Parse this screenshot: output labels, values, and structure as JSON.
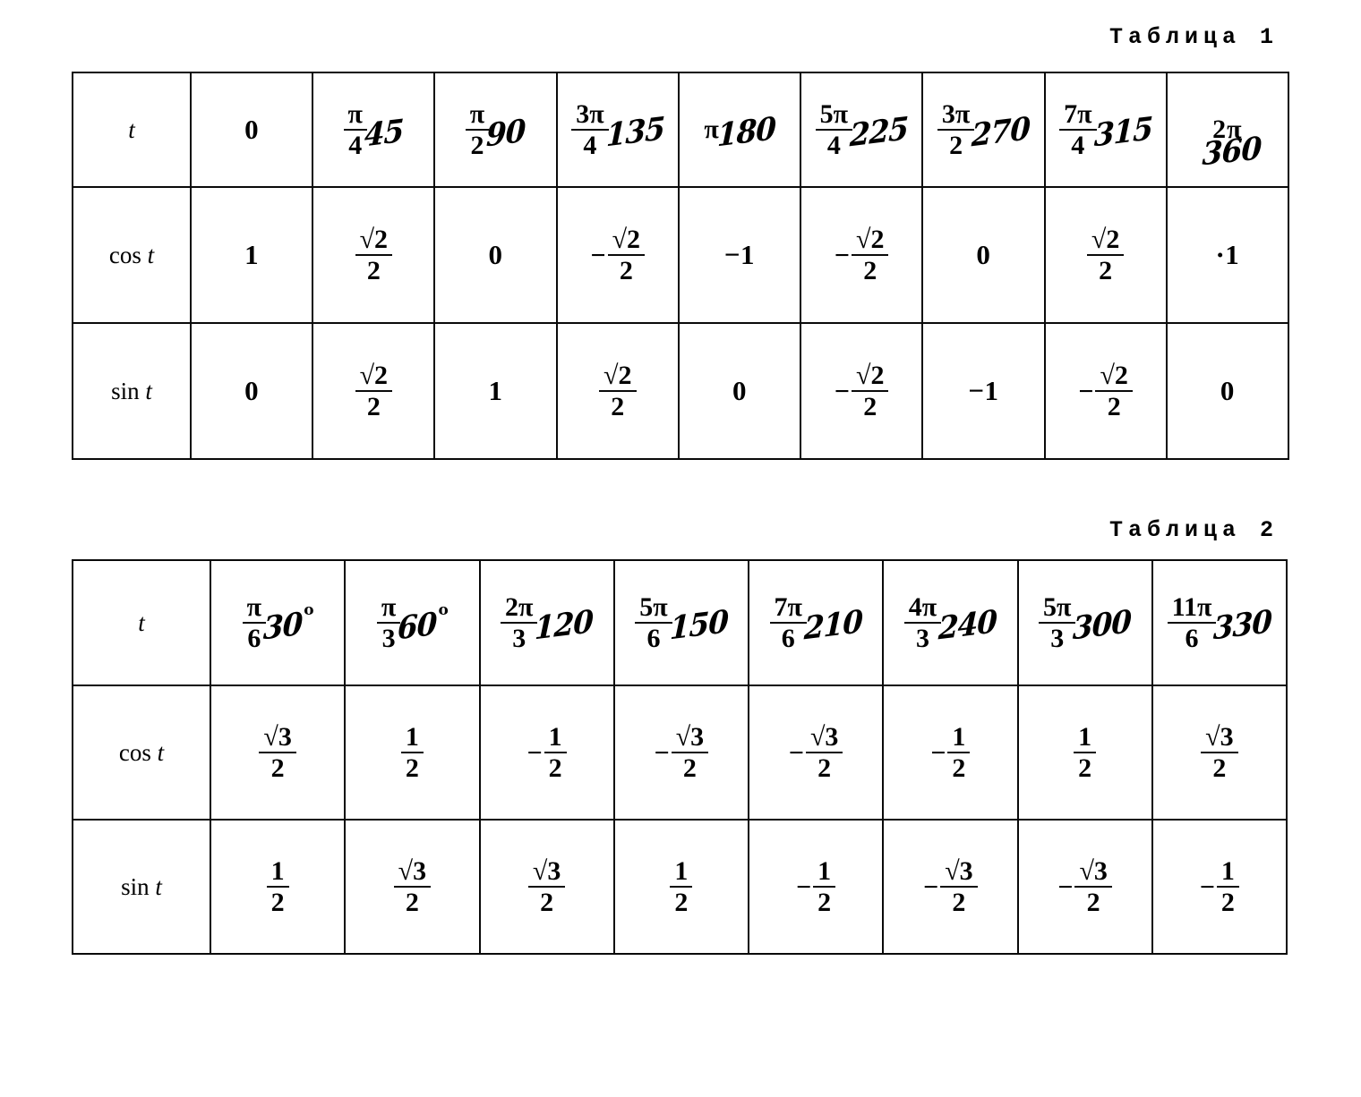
{
  "tables": [
    {
      "caption": "Таблица 1",
      "row_labels": {
        "t": "t",
        "cos": "cos",
        "sin": "sin",
        "var": "t"
      },
      "columns": [
        {
          "printed": "0",
          "printed_kind": "scalar",
          "hand": ""
        },
        {
          "printed": "π/4",
          "printed_kind": "fraction",
          "num": "π",
          "den": "4",
          "hand": "45"
        },
        {
          "printed": "π/2",
          "printed_kind": "fraction",
          "num": "π",
          "den": "2",
          "hand": "90"
        },
        {
          "printed": "3π/4",
          "printed_kind": "fraction",
          "num": "3π",
          "den": "4",
          "hand": "135"
        },
        {
          "printed": "π",
          "printed_kind": "inline",
          "hand": "180"
        },
        {
          "printed": "5π/4",
          "printed_kind": "fraction",
          "num": "5π",
          "den": "4",
          "hand": "225"
        },
        {
          "printed": "3π/2",
          "printed_kind": "fraction",
          "num": "3π",
          "den": "2",
          "hand": "270"
        },
        {
          "printed": "7π/4",
          "printed_kind": "fraction",
          "num": "7π",
          "den": "4",
          "hand": "315"
        },
        {
          "printed": "2π",
          "printed_kind": "inline",
          "hand": "360",
          "hand_position": "below"
        }
      ],
      "cos_values": [
        {
          "sign": "",
          "kind": "scalar",
          "text": "1"
        },
        {
          "sign": "",
          "kind": "fraction",
          "num": "√2",
          "den": "2"
        },
        {
          "sign": "",
          "kind": "scalar",
          "text": "0"
        },
        {
          "sign": "−",
          "kind": "fraction",
          "num": "√2",
          "den": "2"
        },
        {
          "sign": "",
          "kind": "scalar",
          "text": "−1"
        },
        {
          "sign": "−",
          "kind": "fraction",
          "num": "√2",
          "den": "2"
        },
        {
          "sign": "",
          "kind": "scalar",
          "text": "0"
        },
        {
          "sign": "",
          "kind": "fraction",
          "num": "√2",
          "den": "2"
        },
        {
          "sign": "",
          "kind": "scalar",
          "text": "·1"
        }
      ],
      "sin_values": [
        {
          "sign": "",
          "kind": "scalar",
          "text": "0"
        },
        {
          "sign": "",
          "kind": "fraction",
          "num": "√2",
          "den": "2"
        },
        {
          "sign": "",
          "kind": "scalar",
          "text": "1"
        },
        {
          "sign": "",
          "kind": "fraction",
          "num": "√2",
          "den": "2"
        },
        {
          "sign": "",
          "kind": "scalar",
          "text": "0"
        },
        {
          "sign": "−",
          "kind": "fraction",
          "num": "√2",
          "den": "2"
        },
        {
          "sign": "",
          "kind": "scalar",
          "text": "−1"
        },
        {
          "sign": "−",
          "kind": "fraction",
          "num": "√2",
          "den": "2"
        },
        {
          "sign": "",
          "kind": "scalar",
          "text": "0"
        }
      ]
    },
    {
      "caption": "Таблица 2",
      "row_labels": {
        "t": "t",
        "cos": "cos",
        "sin": "sin",
        "var": "t"
      },
      "columns": [
        {
          "printed": "π/6",
          "printed_kind": "fraction",
          "num": "π",
          "den": "6",
          "hand": "30",
          "degree_sign": "o"
        },
        {
          "printed": "π/3",
          "printed_kind": "fraction",
          "num": "π",
          "den": "3",
          "hand": "60",
          "degree_sign": "o"
        },
        {
          "printed": "2π/3",
          "printed_kind": "fraction",
          "num": "2π",
          "den": "3",
          "hand": "120"
        },
        {
          "printed": "5π/6",
          "printed_kind": "fraction",
          "num": "5π",
          "den": "6",
          "hand": "150"
        },
        {
          "printed": "7π/6",
          "printed_kind": "fraction",
          "num": "7π",
          "den": "6",
          "hand": "210"
        },
        {
          "printed": "4π/3",
          "printed_kind": "fraction",
          "num": "4π",
          "den": "3",
          "hand": "240"
        },
        {
          "printed": "5π/3",
          "printed_kind": "fraction",
          "num": "5π",
          "den": "3",
          "hand": "300"
        },
        {
          "printed": "11π/6",
          "printed_kind": "fraction",
          "num": "11π",
          "den": "6",
          "hand": "330"
        }
      ],
      "cos_values": [
        {
          "sign": "",
          "kind": "fraction",
          "num": "√3",
          "den": "2"
        },
        {
          "sign": "",
          "kind": "fraction",
          "num": "1",
          "den": "2"
        },
        {
          "sign": "−",
          "kind": "fraction",
          "num": "1",
          "den": "2"
        },
        {
          "sign": "−",
          "kind": "fraction",
          "num": "√3",
          "den": "2"
        },
        {
          "sign": "−",
          "kind": "fraction",
          "num": "√3",
          "den": "2"
        },
        {
          "sign": "−",
          "kind": "fraction",
          "num": "1",
          "den": "2"
        },
        {
          "sign": "",
          "kind": "fraction",
          "num": "1",
          "den": "2"
        },
        {
          "sign": "",
          "kind": "fraction",
          "num": "√3",
          "den": "2"
        }
      ],
      "sin_values": [
        {
          "sign": "",
          "kind": "fraction",
          "num": "1",
          "den": "2"
        },
        {
          "sign": "",
          "kind": "fraction",
          "num": "√3",
          "den": "2"
        },
        {
          "sign": "",
          "kind": "fraction",
          "num": "√3",
          "den": "2"
        },
        {
          "sign": "",
          "kind": "fraction",
          "num": "1",
          "den": "2"
        },
        {
          "sign": "−",
          "kind": "fraction",
          "num": "1",
          "den": "2"
        },
        {
          "sign": "−",
          "kind": "fraction",
          "num": "√3",
          "den": "2"
        },
        {
          "sign": "−",
          "kind": "fraction",
          "num": "√3",
          "den": "2"
        },
        {
          "sign": "−",
          "kind": "fraction",
          "num": "1",
          "den": "2"
        }
      ]
    }
  ]
}
